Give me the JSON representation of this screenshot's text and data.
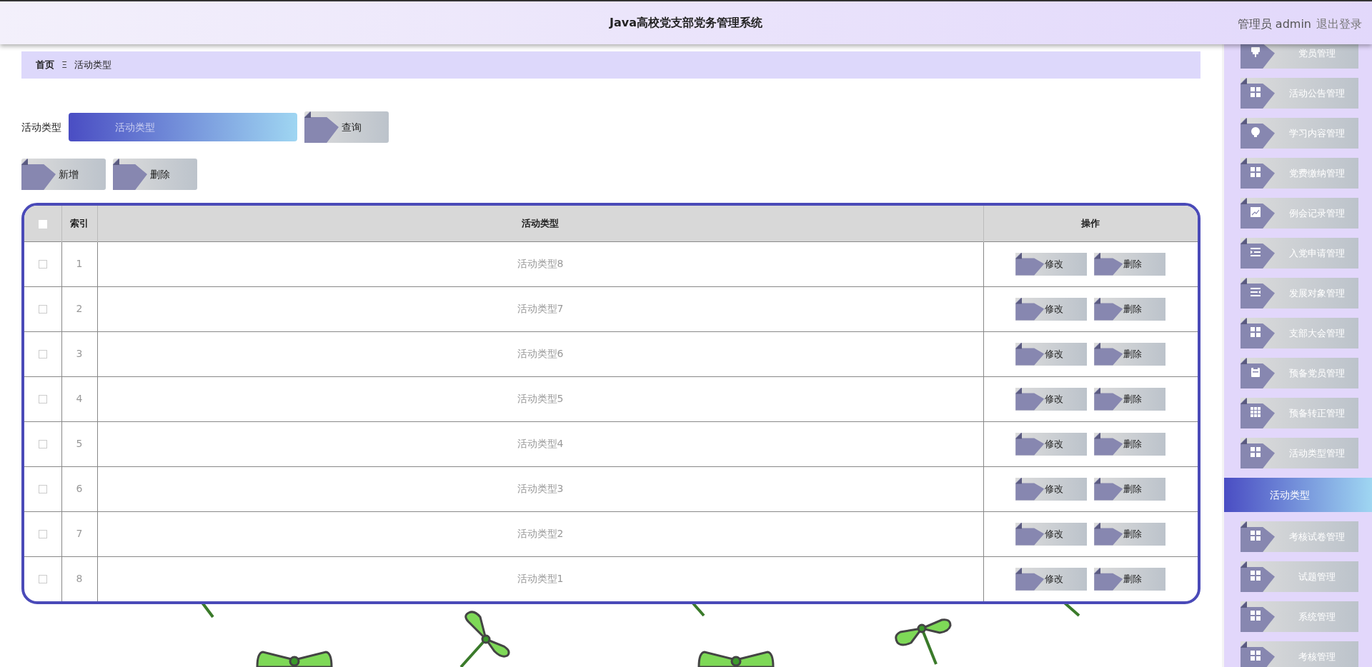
{
  "header": {
    "title": "Java高校党支部党务管理系统",
    "user": "管理员 admin",
    "logout": "退出登录"
  },
  "breadcrumb": {
    "home": "首页",
    "separator": "Ξ",
    "current": "活动类型"
  },
  "search": {
    "label": "活动类型",
    "placeholder": "活动类型",
    "button": "查询"
  },
  "actions": [
    "新增",
    "删除"
  ],
  "table": {
    "select_all_checked": false,
    "columns": [
      "索引",
      "活动类型",
      "操作"
    ],
    "rows": [
      {
        "index": "1",
        "type": "活动类型8",
        "checked": false,
        "buttons": [
          "修改",
          "删除"
        ]
      },
      {
        "index": "2",
        "type": "活动类型7",
        "checked": false,
        "buttons": [
          "修改",
          "删除"
        ]
      },
      {
        "index": "3",
        "type": "活动类型6",
        "checked": false,
        "buttons": [
          "修改",
          "删除"
        ]
      },
      {
        "index": "4",
        "type": "活动类型5",
        "checked": false,
        "buttons": [
          "修改",
          "删除"
        ]
      },
      {
        "index": "5",
        "type": "活动类型4",
        "checked": false,
        "buttons": [
          "修改",
          "删除"
        ]
      },
      {
        "index": "6",
        "type": "活动类型3",
        "checked": false,
        "buttons": [
          "修改",
          "删除"
        ]
      },
      {
        "index": "7",
        "type": "活动类型2",
        "checked": false,
        "buttons": [
          "修改",
          "删除"
        ]
      },
      {
        "index": "8",
        "type": "活动类型1",
        "checked": false,
        "buttons": [
          "修改",
          "删除"
        ]
      }
    ]
  },
  "sidebar": {
    "items": [
      {
        "label": "党员管理",
        "selected": false
      },
      {
        "label": "活动公告管理",
        "selected": false
      },
      {
        "label": "学习内容管理",
        "selected": false
      },
      {
        "label": "党费缴纳管理",
        "selected": false
      },
      {
        "label": "例会记录管理",
        "selected": false
      },
      {
        "label": "入党申请管理",
        "selected": false
      },
      {
        "label": "发展对象管理",
        "selected": false
      },
      {
        "label": "支部大会管理",
        "selected": false
      },
      {
        "label": "预备党员管理",
        "selected": false
      },
      {
        "label": "预备转正管理",
        "selected": false
      },
      {
        "label": "活动类型管理",
        "selected": false
      },
      {
        "label": "活动类型",
        "selected": true
      },
      {
        "label": "考核试卷管理",
        "selected": false
      },
      {
        "label": "试题管理",
        "selected": false
      },
      {
        "label": "系统管理",
        "selected": false
      },
      {
        "label": "考核管理",
        "selected": false
      }
    ]
  }
}
